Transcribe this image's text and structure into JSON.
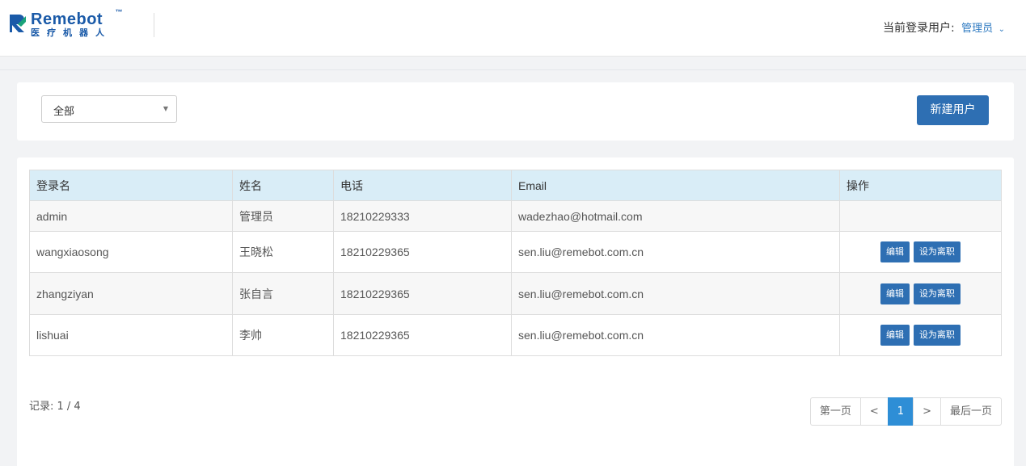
{
  "header": {
    "logo_brand": "Remebot",
    "logo_tm": "™",
    "logo_sub": "医疗机器人",
    "user_label": "当前登录用户:",
    "user_name": "管理员",
    "user_menu_icon": "chevron-down-icon"
  },
  "filter": {
    "selected": "全部",
    "new_user_button": "新建用户"
  },
  "table": {
    "columns": [
      "登录名",
      "姓名",
      "电话",
      "Email",
      "操作"
    ],
    "rows": [
      {
        "login": "admin",
        "name": "管理员",
        "phone": "18210229333",
        "email": "wadezhao@hotmail.com",
        "actions": []
      },
      {
        "login": "wangxiaosong",
        "name": "王晓松",
        "phone": "18210229365",
        "email": "sen.liu@remebot.com.cn",
        "actions": [
          "编辑",
          "设为离职"
        ]
      },
      {
        "login": "zhangziyan",
        "name": "张自言",
        "phone": "18210229365",
        "email": "sen.liu@remebot.com.cn",
        "actions": [
          "编辑",
          "设为离职"
        ]
      },
      {
        "login": "lishuai",
        "name": "李帅",
        "phone": "18210229365",
        "email": "sen.liu@remebot.com.cn",
        "actions": [
          "编辑",
          "设为离职"
        ]
      }
    ]
  },
  "footer": {
    "record_count": "记录: 1 / 4",
    "pagination": {
      "first": "第一页",
      "prev": "<",
      "current": "1",
      "next": ">",
      "last": "最后一页"
    }
  },
  "colors": {
    "brand": "#1a5aa8",
    "primary_button": "#2e6fb3",
    "table_header": "#d9edf7",
    "active_page": "#2e8ed6"
  }
}
